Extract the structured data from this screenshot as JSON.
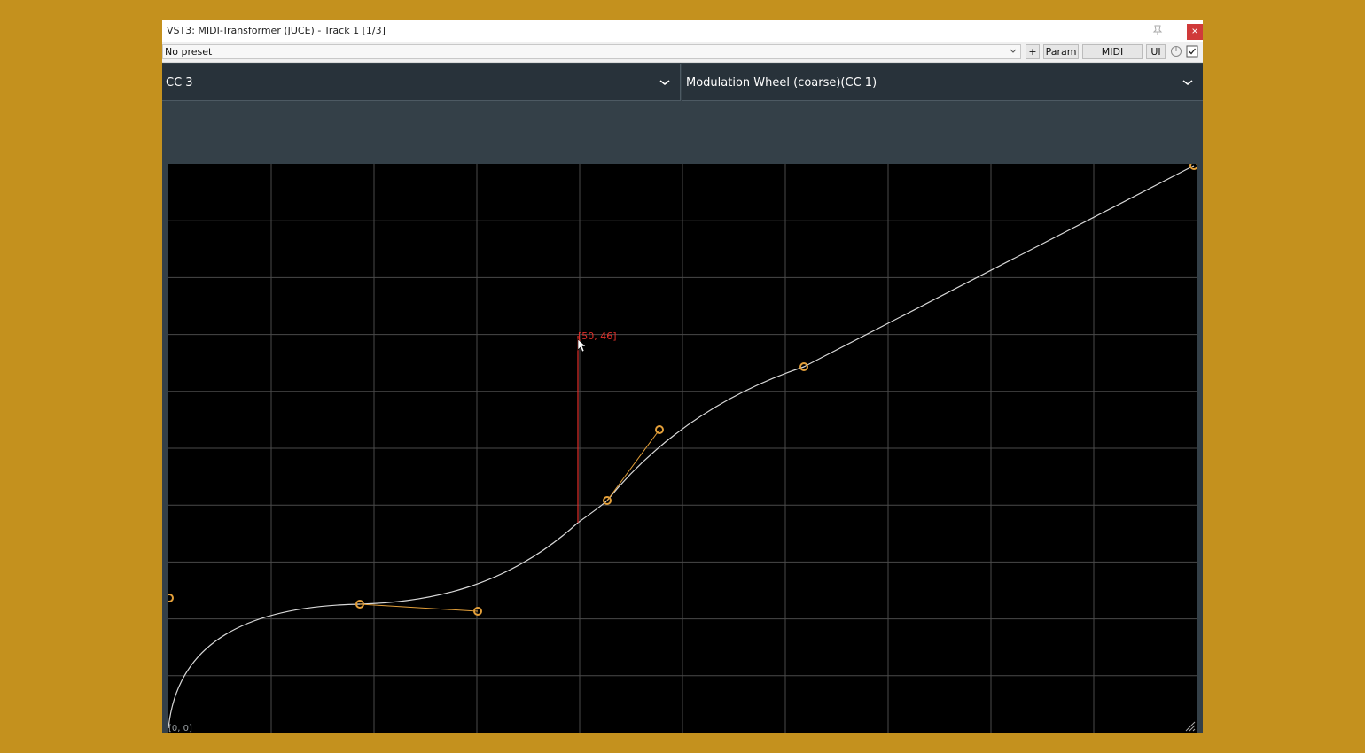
{
  "window": {
    "title": "VST3: MIDI-Transformer (JUCE) - Track 1 [1/3]",
    "close_label": "×"
  },
  "toolbar": {
    "preset_value": "No preset",
    "plus_label": "+",
    "param_label": "Param",
    "midi_label": "MIDI",
    "ui_label": "UI"
  },
  "plugin": {
    "source_cc": "CC 3",
    "target_cc": "Modulation Wheel (coarse)(CC 1)"
  },
  "curve": {
    "cursor_readout": "[50, 46]",
    "origin_readout": "[0, 0]",
    "x_max": 127,
    "y_max": 127,
    "grid_divisions": 10,
    "colors": {
      "curve": "#d8d8d8",
      "handle": "#e4a03a",
      "grid": "#4a4a4a",
      "cursor": "#e0302a"
    }
  }
}
